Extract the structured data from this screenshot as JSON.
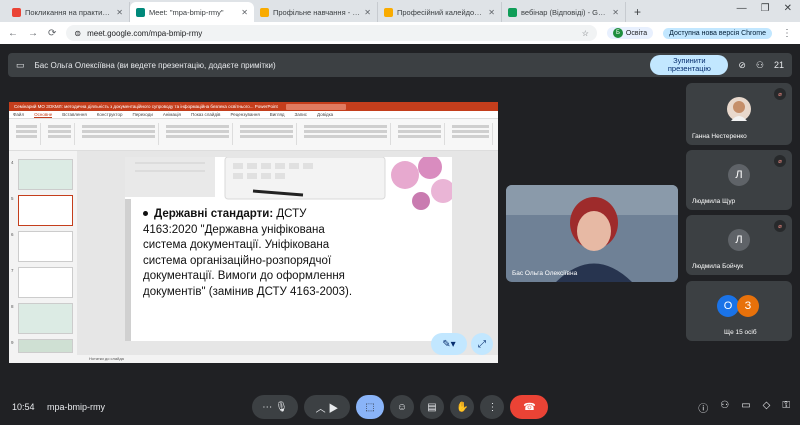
{
  "browser": {
    "tabs": [
      {
        "label": "Покликання на практикум - o",
        "color": "#ea4335",
        "active": false
      },
      {
        "label": "Meet: \"mpa-bmip-rmy\"",
        "color": "#00897b",
        "active": true
      },
      {
        "label": "Профільне навчання - lino",
        "color": "#f9ab00",
        "active": false
      },
      {
        "label": "Професійний калейдоскоп - f",
        "color": "#f9ab00",
        "active": false
      },
      {
        "label": "вебінар (Відповіді) - Google T",
        "color": "#0f9d58",
        "active": false
      }
    ],
    "new_tab": "+",
    "url": "meet.google.com/mpa-bmip-rmy",
    "profile_initial": "Б",
    "profile_label": "Освіта",
    "update_label": "Доступна нова версія Chrome"
  },
  "presenting": {
    "text": "Бас Ольга Олексіївна (ви ведете презентацію, додаєте примітки)",
    "stop_label": "Зупинити презентацію",
    "people_count": "21"
  },
  "slide": {
    "title_bold": "Державні стандарти:",
    "body_1": " ДСТУ 4163:2020 \"",
    "body_bold": "Державна уніфікована система документації. Уніфікована система організаційно-розпорядчої документації. Вимоги до оформлення документів",
    "body_2": "\" (замінив ДСТУ 4163-2003).",
    "notes_label": "Нотатки до слайда"
  },
  "ppt": {
    "title": "Семінарий МО ЗОКМЛ: методична діяльність з документаційного супроводу та інформаційна безпека освітнього... PowerPoint",
    "menu": [
      "Файл",
      "Основне",
      "Вставлення",
      "Конструктор",
      "Переходи",
      "Анімація",
      "Показ слайдів",
      "Рецензування",
      "Вигляд",
      "Запис",
      "Довідка"
    ],
    "thumb_numbers": [
      "4",
      "5",
      "6",
      "7",
      "8",
      "9"
    ]
  },
  "participants": [
    {
      "name": "Ганна Нестеренко",
      "muted": true,
      "initial": "",
      "color": "#5f6368"
    },
    {
      "name": "Людмила Щур",
      "muted": true,
      "initial": "Л",
      "color": "#5f6368"
    },
    {
      "name": "Людмила Бойчук",
      "muted": true,
      "initial": "Л",
      "color": "#5f6368"
    }
  ],
  "more": {
    "label": "Ще 15 осіб",
    "avatar_1": "O",
    "avatar_2": "З"
  },
  "self_tile": {
    "name": "Бас Ольга Олексіївна"
  },
  "bottom": {
    "time": "10:54",
    "meet_code": "mpa-bmip-rmy"
  },
  "colors": {
    "accent": "#8ab4f8",
    "end": "#ea4335",
    "ppt": "#c43e1c"
  }
}
